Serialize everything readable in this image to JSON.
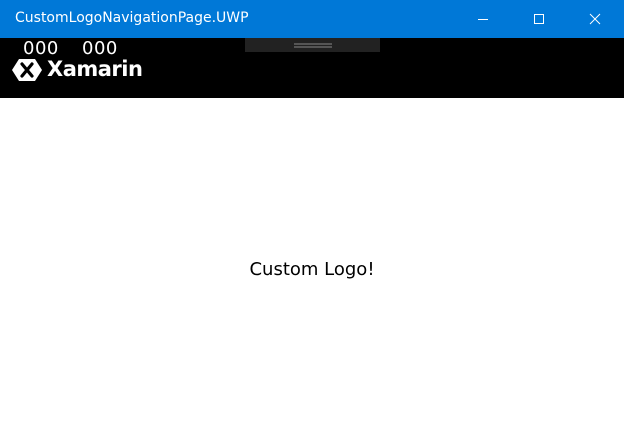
{
  "window": {
    "title": "CustomLogoNavigationPage.UWP",
    "title_bar_color": "#0078d7",
    "controls": [
      "minimize-icon",
      "maximize-icon",
      "close-icon"
    ]
  },
  "navigation_bar": {
    "background_color": "#000000",
    "counter_left": "000",
    "counter_right": "000",
    "logo": {
      "icon": "xamarin-logo-icon",
      "wordmark": "Xamarin"
    }
  },
  "content": {
    "label": "Custom Logo!"
  }
}
